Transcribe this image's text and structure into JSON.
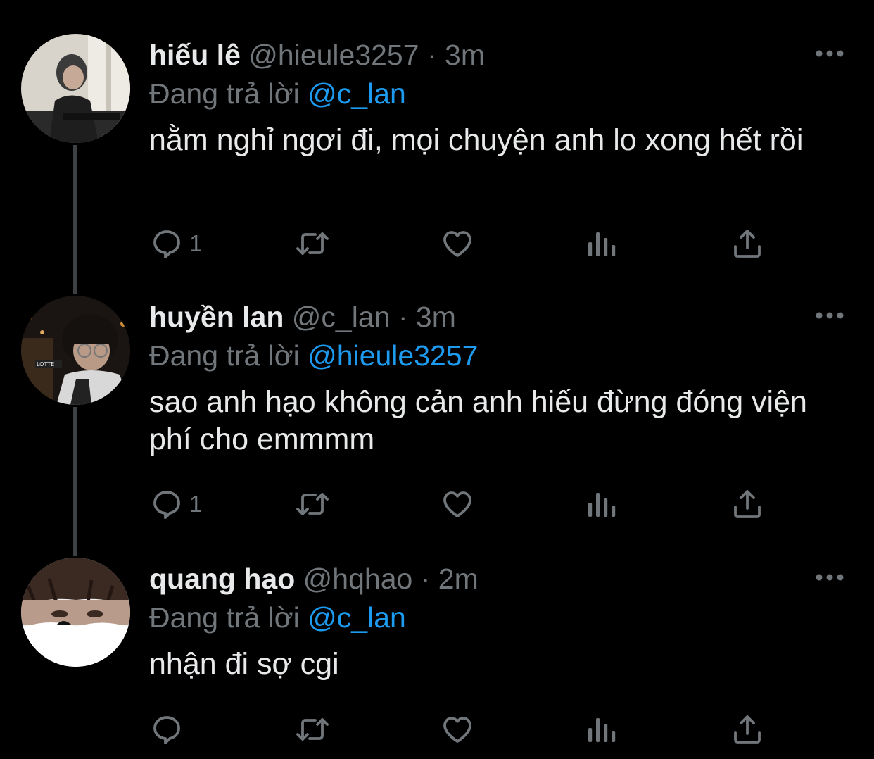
{
  "colors": {
    "background": "#000000",
    "text_primary": "#e7e9ea",
    "text_secondary": "#71767b",
    "mention": "#1d9bf0",
    "thread_line": "#3e4144"
  },
  "tweets": [
    {
      "display_name": "hiếu lê",
      "handle": "@hieule3257",
      "separator": "·",
      "time": "3m",
      "reply_prefix": "Đang trả lời",
      "reply_to": "@c_lan",
      "text": "nằm nghỉ ngơi đi, mọi chuyện anh lo xong hết rồi",
      "reply_count": "1",
      "icons": [
        "more-icon",
        "reply-icon",
        "retweet-icon",
        "like-icon",
        "analytics-icon",
        "share-icon"
      ]
    },
    {
      "display_name": "huyền lan",
      "handle": "@c_lan",
      "separator": "·",
      "time": "3m",
      "reply_prefix": "Đang trả lời",
      "reply_to": "@hieule3257",
      "text": "sao anh hạo không cản anh hiếu đừng đóng viện phí cho emmmm",
      "reply_count": "1",
      "icons": [
        "more-icon",
        "reply-icon",
        "retweet-icon",
        "like-icon",
        "analytics-icon",
        "share-icon"
      ]
    },
    {
      "display_name": "quang hạo",
      "handle": "@hqhao",
      "separator": "·",
      "time": "2m",
      "reply_prefix": "Đang trả lời",
      "reply_to": "@c_lan",
      "text": "nhận đi sợ cgi",
      "reply_count": "",
      "icons": [
        "more-icon",
        "reply-icon",
        "retweet-icon",
        "like-icon",
        "analytics-icon",
        "share-icon"
      ]
    }
  ]
}
